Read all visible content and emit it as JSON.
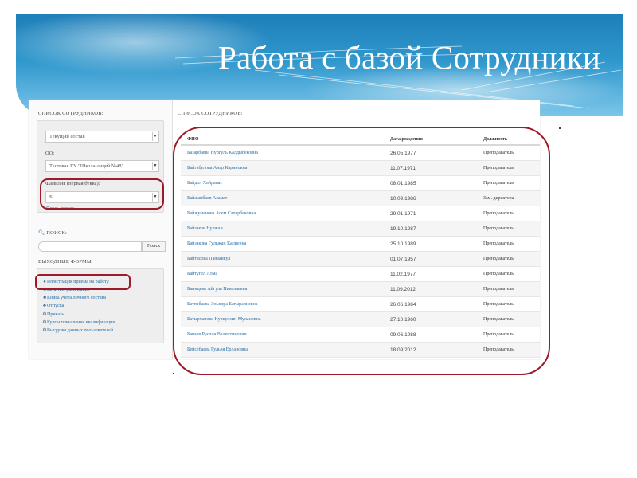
{
  "slide": {
    "title": "Работа с базой Сотрудники"
  },
  "left": {
    "list_heading": "Список сотрудников:",
    "status_select": "Текущий состав",
    "org_label": "ОО:",
    "org_select": "Тестовая ГУ \"Школа-лицей №48\"",
    "letter_label": "Фамилия (первая буква):",
    "letter_select": "Б",
    "full_list_link": "весь список",
    "search_heading": "Поиск:",
    "search_button": "Поиск",
    "forms_heading": "Выходные формы:",
    "forms": [
      "Регистрация приема на работу",
      "Штатное расписание",
      "Книга учета личного состава",
      "Отпуска",
      "Приказы",
      "Курсы повышения квалификации",
      "Выгрузка данных пользователей"
    ]
  },
  "right": {
    "heading": "Список сотрудников:",
    "columns": [
      "ФИО",
      "Дата рождения",
      "Должность"
    ],
    "rows": [
      [
        "Базарбаева Нургуль Калдыбековна",
        "26.05.1977",
        "Преподаватель"
      ],
      [
        "Байгабулова Анар Кариновна",
        "11.07.1971",
        "Преподаватель"
      ],
      [
        "Байдол Хайрапас",
        "08.01.1985",
        "Преподаватель"
      ],
      [
        "Байжанбаев Азамат",
        "10.09.1986",
        "Зам. директора"
      ],
      [
        "Байжуманова Асем Сапарбековна",
        "29.01.1971",
        "Преподаватель"
      ],
      [
        "Байзаков Нуржан",
        "19.10.1987",
        "Преподаватель"
      ],
      [
        "Байзакова Гульжан Калиевна",
        "25.10.1989",
        "Преподаватель"
      ],
      [
        "Байтасова Панзаикул",
        "01.07.1957",
        "Преподаватель"
      ],
      [
        "Байтугел Алма",
        "11.02.1977",
        "Преподаватель"
      ],
      [
        "Баннцева Айгуль Николаевна",
        "11.09.2012",
        "Преподаватель"
      ],
      [
        "Батпабаева Эльвира Батыралиевна",
        "26.06.1984",
        "Преподаватель"
      ],
      [
        "Батырханова Нуркулсин Мухановна",
        "27.10.1960",
        "Преподаватель"
      ],
      [
        "Бачаев Руслан Валентинович",
        "09.06.1988",
        "Преподаватель"
      ],
      [
        "Бейсебаева Гульвя Ерлановна",
        "18.09.2012",
        "Преподаватель"
      ]
    ]
  },
  "colors": {
    "banner": "#2f97cc",
    "link": "#2a6fa8",
    "highlight": "#9c1a2a"
  },
  "icons": [
    "dropdown-arrow-icon",
    "search-icon",
    "user-icon",
    "document-icon",
    "book-icon",
    "vacation-icon",
    "gear-icon",
    "download-icon"
  ]
}
